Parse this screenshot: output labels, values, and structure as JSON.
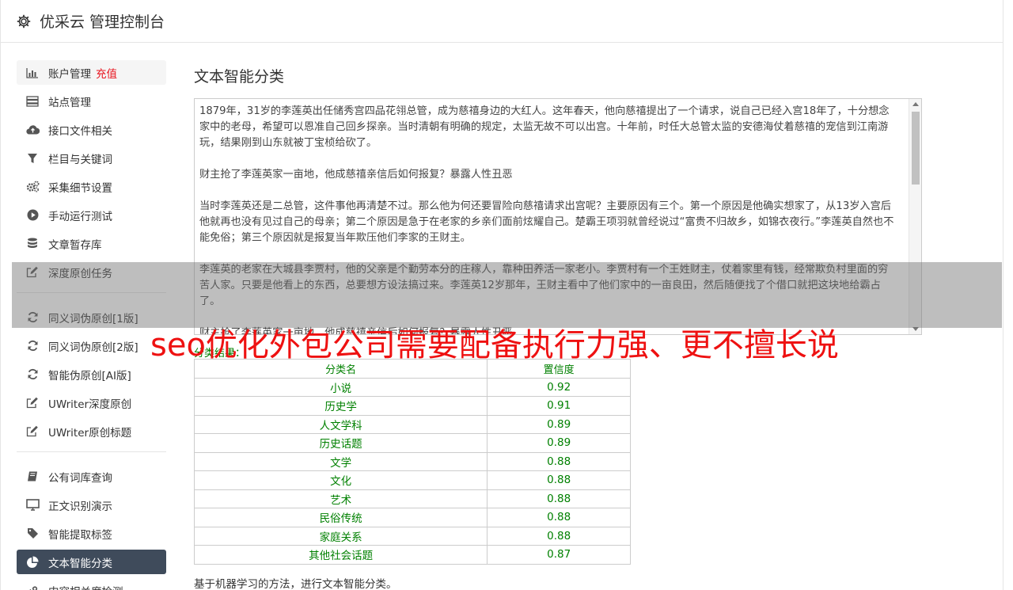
{
  "header": {
    "title": "优采云 管理控制台"
  },
  "sidebar": {
    "groups": [
      [
        {
          "label": "账户管理",
          "badge": "充值",
          "icon": "bar-chart-icon",
          "state": "hover"
        },
        {
          "label": "站点管理",
          "icon": "server-icon"
        },
        {
          "label": "接口文件相关",
          "icon": "cloud-upload-icon"
        },
        {
          "label": "栏目与关键词",
          "icon": "filter-icon"
        },
        {
          "label": "采集细节设置",
          "icon": "cogs-icon"
        },
        {
          "label": "手动运行测试",
          "icon": "play-icon"
        },
        {
          "label": "文章暂存库",
          "icon": "database-icon"
        },
        {
          "label": "深度原创任务",
          "icon": "edit-icon"
        }
      ],
      [
        {
          "label": "同义词伪原创[1版]",
          "icon": "refresh-icon"
        },
        {
          "label": "同义词伪原创[2版]",
          "icon": "refresh-icon"
        },
        {
          "label": "智能伪原创[AI版]",
          "icon": "refresh-icon"
        },
        {
          "label": "UWriter深度原创",
          "icon": "edit-icon"
        },
        {
          "label": "UWriter原创标题",
          "icon": "edit-icon"
        }
      ],
      [
        {
          "label": "公有词库查询",
          "icon": "book-icon"
        },
        {
          "label": "正文识别演示",
          "icon": "monitor-icon"
        },
        {
          "label": "智能提取标签",
          "icon": "tag-icon"
        },
        {
          "label": "文本智能分类",
          "icon": "pie-chart-icon",
          "state": "active"
        },
        {
          "label": "内容相关度检测",
          "icon": "link-icon"
        }
      ]
    ]
  },
  "main": {
    "title": "文本智能分类",
    "article": [
      "1879年，31岁的李莲英出任储秀宫四品花翎总管，成为慈禧身边的大红人。这年春天，他向慈禧提出了一个请求，说自己已经入宫18年了，十分想念家中的老母，希望可以恩准自己回乡探亲。当时清朝有明确的规定，太监无故不可以出宫。十年前，时任大总管太监的安德海仗着慈禧的宠信到江南游玩，结果刚到山东就被丁宝桢给砍了。",
      "财主抢了李莲英家一亩地，他成慈禧亲信后如何报复？暴露人性丑恶",
      "当时李莲英还是二总管，这件事他再清楚不过。那么他为何还要冒险向慈禧请求出宫呢？主要原因有三个。第一个原因是他确实想家了，从13岁入宫后他就再也没有见过自己的母亲；第二个原因是急于在老家的乡亲们面前炫耀自己。楚霸王项羽就曾经说过“富贵不归故乡，如锦衣夜行。”李莲英自然也不能免俗；第三个原因就是报复当年欺压他们李家的王财主。",
      "李莲英的老家在大城县李贾村，他的父亲是个勤劳本分的庄稼人，靠种田养活一家老小。李贾村有一个王姓财主，仗着家里有钱，经常欺负村里面的穷苦人家。只要是他看上的东西，总要想方设法搞过来。李莲英12岁那年，王财主看中了他们家中的一亩良田，然后随便找了个借口就把这块地给霸占了。",
      "财主抢了李莲英家一亩地，他成慈禧亲信后如何报复？暴露人性丑恶"
    ],
    "result_label": "分类结果：",
    "table": {
      "headers": [
        "分类名",
        "置信度"
      ],
      "rows": [
        [
          "小说",
          "0.92"
        ],
        [
          "历史学",
          "0.91"
        ],
        [
          "人文学科",
          "0.89"
        ],
        [
          "历史话题",
          "0.89"
        ],
        [
          "文学",
          "0.88"
        ],
        [
          "文化",
          "0.88"
        ],
        [
          "艺术",
          "0.88"
        ],
        [
          "民俗传统",
          "0.88"
        ],
        [
          "家庭关系",
          "0.88"
        ],
        [
          "其他社会话题",
          "0.87"
        ]
      ]
    },
    "description": "基于机器学习的方法，进行文本智能分类。"
  },
  "overlay": {
    "text": "seo优化外包公司需要配备执行力强、更不擅长说"
  },
  "colors": {
    "active_bg": "#3f4b5b",
    "result_green": "#008000",
    "badge_red": "#e8141e",
    "overlay_red": "#ee1111"
  }
}
